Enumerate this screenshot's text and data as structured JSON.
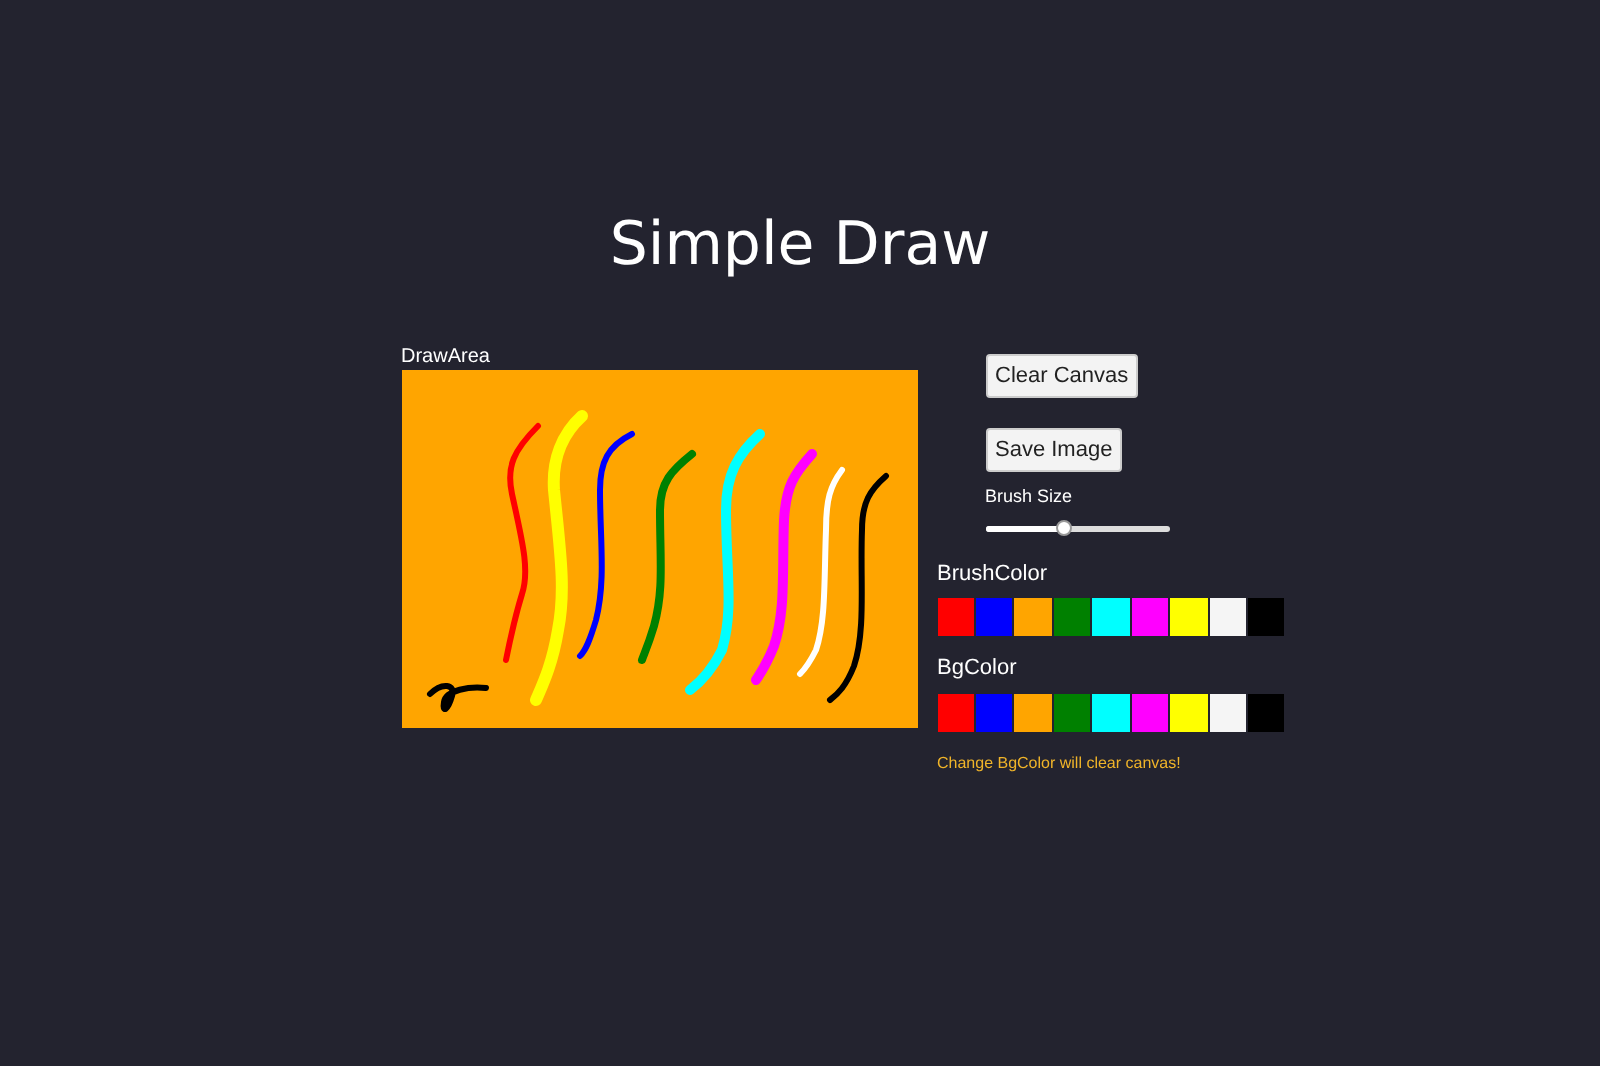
{
  "title": "Simple Draw",
  "draw_area": {
    "label": "DrawArea"
  },
  "buttons": [
    "Clear Canvas",
    "Save Image"
  ],
  "brush_size": {
    "label": "Brush Size",
    "level": 0.43
  },
  "brush_color": {
    "label": "BrushColor",
    "swatches": [
      {
        "color": "#ff0000"
      },
      {
        "color": "#0000ff"
      },
      {
        "color": "#ffa500"
      },
      {
        "color": "#008000"
      },
      {
        "color": "#00ffff"
      },
      {
        "color": "#ff00ff"
      },
      {
        "color": "#ffff00"
      },
      {
        "color": "#f5f5f5"
      },
      {
        "color": "#000000"
      }
    ]
  },
  "bg_color": {
    "label": "BgColor",
    "swatches": [
      {
        "color": "#ff0000"
      },
      {
        "color": "#0000ff"
      },
      {
        "color": "#ffa500"
      },
      {
        "color": "#008000"
      },
      {
        "color": "#00ffff"
      },
      {
        "color": "#ff00ff"
      },
      {
        "color": "#ffff00"
      },
      {
        "color": "#f5f5f5"
      },
      {
        "color": "#000000"
      }
    ]
  },
  "warning": "Change BgColor will clear canvas!"
}
